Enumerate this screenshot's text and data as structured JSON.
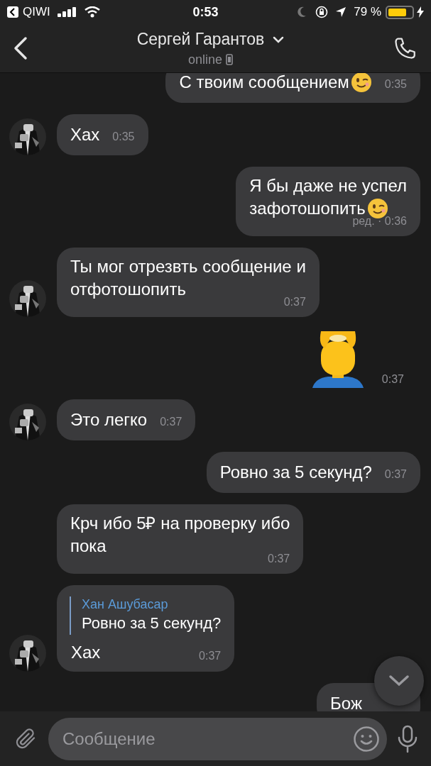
{
  "status_bar": {
    "back_app": "QIWI",
    "time": "0:53",
    "battery": "79 %"
  },
  "header": {
    "title": "Сергей Гарантов",
    "subtitle": "online"
  },
  "messages": [
    {
      "kind": "text",
      "outgoing": true,
      "text": "С твоим сообщением",
      "wink": true,
      "time": "0:35"
    },
    {
      "kind": "text",
      "outgoing": false,
      "text": "Хах",
      "wink": false,
      "time": "0:35",
      "avatar": true
    },
    {
      "kind": "text",
      "outgoing": true,
      "text": "Я бы даже не успел\nзафотошопить",
      "wink": true,
      "time": "ред. · 0:36"
    },
    {
      "kind": "text",
      "outgoing": false,
      "text": "Ты мог отрезвть сообщение и\nотфотошопить",
      "wink": false,
      "time": "0:37",
      "avatar": true
    },
    {
      "kind": "sticker",
      "outgoing": true,
      "time": "0:37"
    },
    {
      "kind": "text",
      "outgoing": false,
      "text": "Это легко",
      "wink": false,
      "time": "0:37",
      "avatar": true
    },
    {
      "kind": "text",
      "outgoing": true,
      "text": "Ровно за 5 секунд?",
      "wink": false,
      "time": "0:37"
    },
    {
      "kind": "text",
      "outgoing": false,
      "text": "Крч ибо 5₽ на проверку ибо\nпока",
      "wink": false,
      "time": "0:37",
      "avatar": false
    },
    {
      "kind": "reply",
      "outgoing": false,
      "quote_author": "Хан Ашубасар",
      "quote_text": "Ровно за 5 секунд?",
      "text": "Хах",
      "time": "0:37",
      "avatar": true
    },
    {
      "kind": "text",
      "outgoing": true,
      "text": "Бож",
      "wink": false
    }
  ],
  "composer": {
    "placeholder": "Сообщение"
  }
}
